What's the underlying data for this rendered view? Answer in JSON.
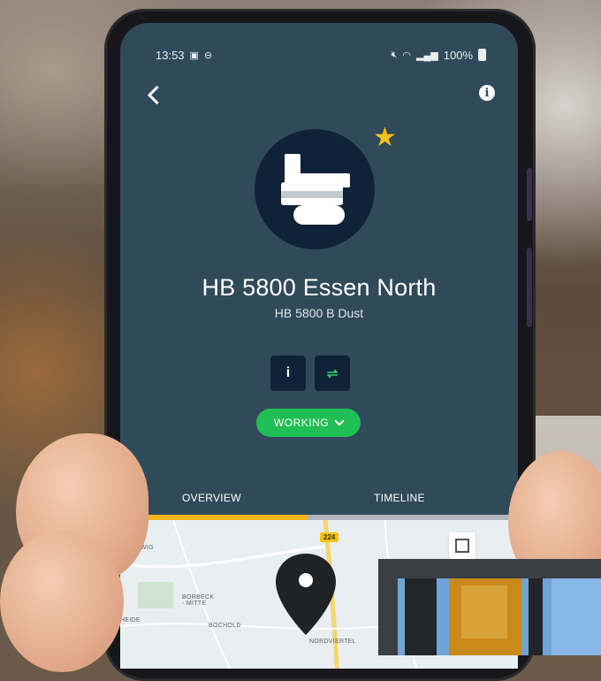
{
  "status_bar": {
    "time": "13:53",
    "battery": "100%"
  },
  "machine": {
    "title": "HB 5800 Essen North",
    "subtitle": "HB 5800 B Dust",
    "favorite": true
  },
  "actions": {
    "info_label": "i",
    "swap_label": "⇌"
  },
  "status": {
    "label": "WORKING"
  },
  "tabs": [
    {
      "label": "OVERVIEW",
      "active": true
    },
    {
      "label": "TIMELINE",
      "active": false
    }
  ],
  "map": {
    "road_number": "224",
    "labels": [
      "DOLLWIG",
      "BORBECK\n- MITTE",
      "BOCHOLD",
      "HEIDE",
      "NORDVIERTEL"
    ]
  },
  "colors": {
    "screen_bg": "#304a5a",
    "navy": "#0f2238",
    "status_green": "#1fbf55",
    "accent_yellow": "#f2b51c"
  }
}
